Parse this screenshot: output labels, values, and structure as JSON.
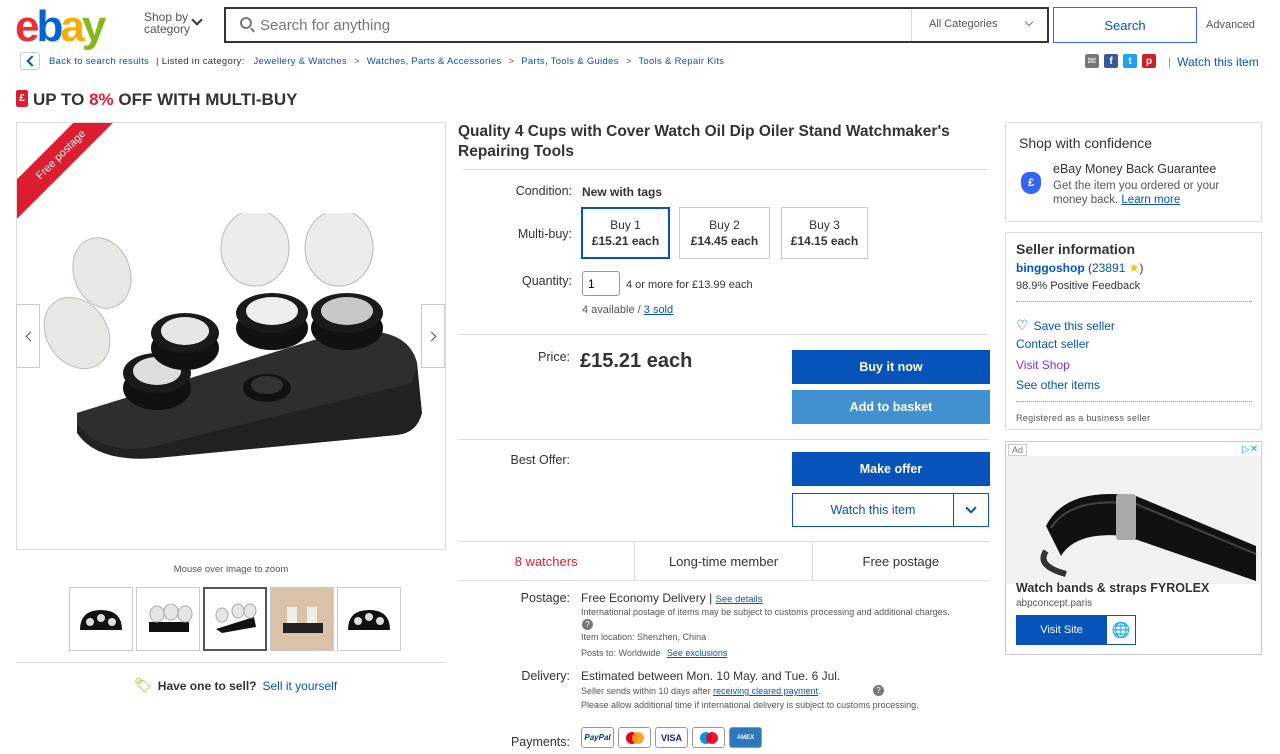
{
  "header": {
    "logo": [
      "e",
      "b",
      "a",
      "y"
    ],
    "shop_by_line1": "Shop by",
    "shop_by_line2": "category",
    "search_placeholder": "Search for anything",
    "category_select": "All Categories",
    "search_button": "Search",
    "advanced": "Advanced"
  },
  "breadcrumb": {
    "back": "Back to search results",
    "listed": "| Listed in category:",
    "items": [
      "Jewellery & Watches",
      "Watches, Parts & Accessories",
      "Parts, Tools & Guides",
      "Tools & Repair Kits"
    ],
    "separator": ">",
    "watch_link": "Watch this item"
  },
  "share": [
    {
      "icon": "email-icon",
      "glyph": "✉",
      "color": "#777777"
    },
    {
      "icon": "facebook-icon",
      "glyph": "f",
      "color": "#3b5998"
    },
    {
      "icon": "twitter-icon",
      "glyph": "t",
      "color": "#1da1f2"
    },
    {
      "icon": "pinterest-icon",
      "glyph": "p",
      "color": "#cb2027"
    }
  ],
  "banner": {
    "prefix": "UP TO ",
    "percent": "8%",
    "suffix": " OFF WITH MULTI-BUY",
    "tag_glyph": "£"
  },
  "gallery": {
    "ribbon": "Free postage",
    "zoom_note": "Mouse over image to zoom",
    "thumb_count": 5,
    "selected_thumb": 3
  },
  "sell": {
    "question": "Have one to sell?",
    "link": "Sell it yourself"
  },
  "product": {
    "title": "Quality 4 Cups with Cover Watch Oil Dip Oiler Stand Watchmaker's Repairing Tools",
    "condition_label": "Condition:",
    "condition": "New with tags",
    "multibuy_label": "Multi-buy:",
    "multibuy": [
      {
        "line1": "Buy 1",
        "line2": "£15.21 each"
      },
      {
        "line1": "Buy 2",
        "line2": "£14.45 each"
      },
      {
        "line1": "Buy 3",
        "line2": "£14.15 each"
      }
    ],
    "quantity_label": "Quantity:",
    "quantity_value": "1",
    "quantity_offer": "4 or more for £13.99 each",
    "available": "4 available / ",
    "sold": "3 sold",
    "price_label": "Price:",
    "price": "£15.21 each",
    "buy_now": "Buy it now",
    "add_basket": "Add to basket",
    "best_offer_label": "Best Offer:",
    "make_offer": "Make offer",
    "watch_button": "Watch this item",
    "stats": [
      "8 watchers",
      "Long-time member",
      "Free postage"
    ],
    "postage_label": "Postage:",
    "postage_free": "Free",
    "postage_method": "Economy Delivery |",
    "postage_details": "See details",
    "postage_intl": "International postage of items may be subject to customs processing and additional charges.",
    "item_location": "Item location:  Shenzhen, China",
    "posts_to": "Posts to:  Worldwide",
    "see_exclusions": "See exclusions",
    "delivery_label": "Delivery:",
    "delivery_prefix": "Estimated between ",
    "delivery_dates": "Mon. 10 May. and Tue. 6 Jul.",
    "delivery_note_prefix": "Seller sends within 10 days after ",
    "delivery_note_link": "receiving cleared payment",
    "delivery_note_period": ".",
    "delivery_extra": "Please allow additional time if international delivery is subject to customs processing.",
    "payments_label": "Payments:",
    "payments": [
      "PayPal",
      "MC",
      "VISA",
      "Maestro",
      "AMEX"
    ]
  },
  "confidence": {
    "title": "Shop with confidence",
    "guarantee": "eBay Money Back Guarantee",
    "desc": "Get the item you ordered or your money back.",
    "learn_more": "Learn more"
  },
  "seller": {
    "title": "Seller information",
    "name": "binggoshop",
    "score": "23891",
    "feedback": "98.9% Positive Feedback",
    "save": "Save this seller",
    "contact": "Contact seller",
    "visit": "Visit Shop",
    "other": "See other items",
    "registered": "Registered as a business seller"
  },
  "ad": {
    "label": "Ad",
    "title": "Watch bands & straps FYROLEX",
    "domain": "abpconcept.paris",
    "cta": "Visit Site"
  },
  "colors": {
    "accent": "#0654ba",
    "red": "#dd1e31",
    "light_button": "#4190d0"
  }
}
